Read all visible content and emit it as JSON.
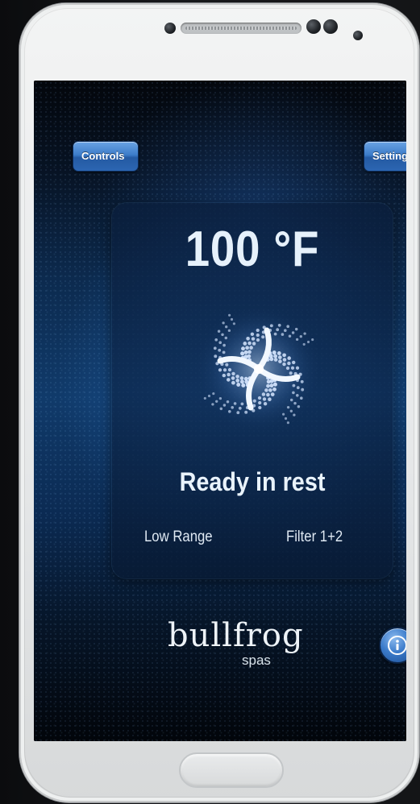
{
  "header": {
    "controls_label": "Controls",
    "settings_label": "Settings"
  },
  "status_panel": {
    "temperature": "100 °F",
    "status_text": "Ready in rest",
    "range_text": "Low Range",
    "filter_text": "Filter 1+2"
  },
  "branding": {
    "logo_text": "bullfrog",
    "logo_sub": "spas"
  },
  "icons": {
    "swirl": "spa-jets-swirl-icon",
    "info": "info-icon"
  },
  "colors": {
    "button_blue": "#3c7cc9",
    "text_light": "#e6f1fb",
    "screen_dark": "#05070b"
  }
}
